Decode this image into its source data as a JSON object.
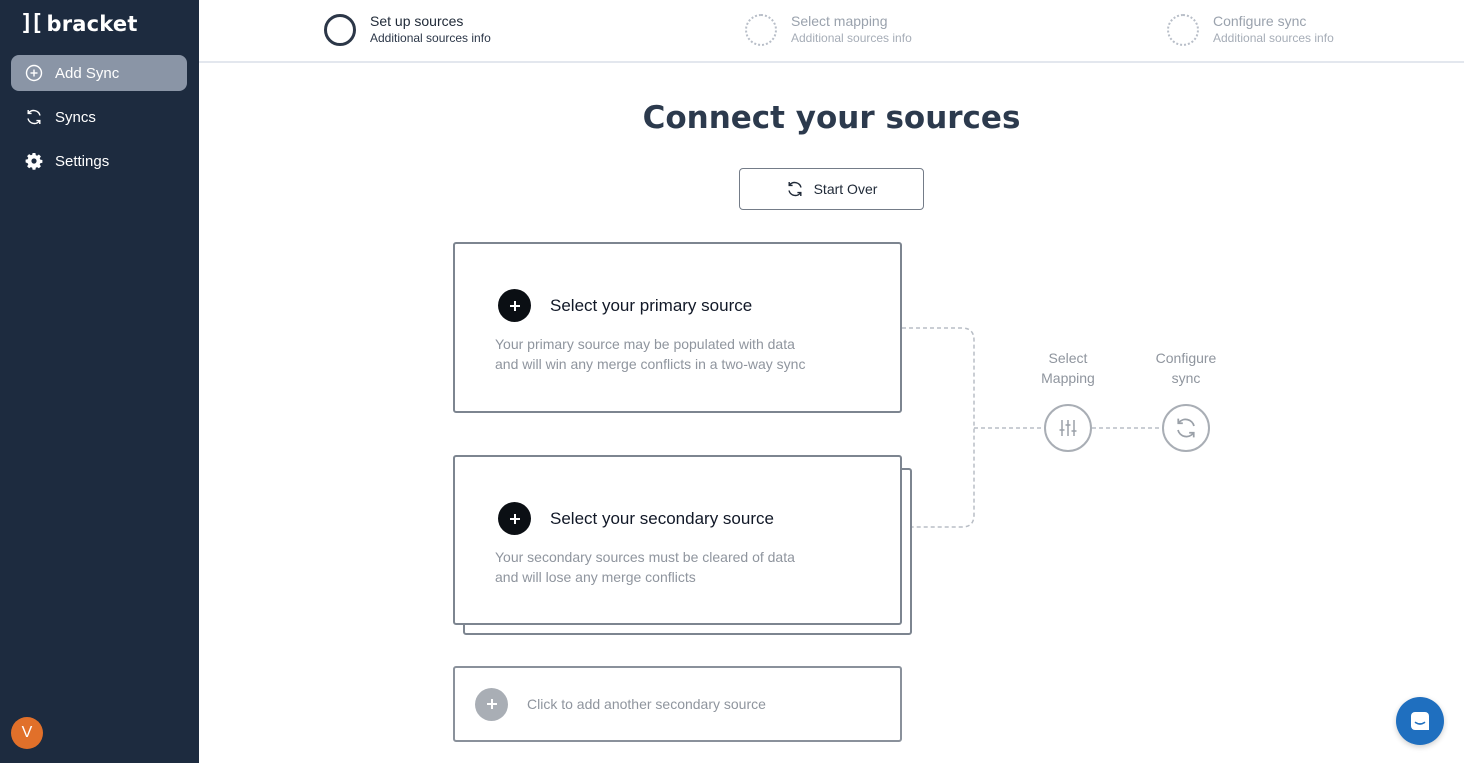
{
  "app": {
    "logo_mark": "][",
    "logo_text": "bracket"
  },
  "sidebar": {
    "items": [
      {
        "label": "Add Sync",
        "icon": "plus-circle-icon",
        "active": true
      },
      {
        "label": "Syncs",
        "icon": "refresh-icon",
        "active": false
      },
      {
        "label": "Settings",
        "icon": "gear-icon",
        "active": false
      }
    ],
    "avatar_initial": "V"
  },
  "stepper": {
    "steps": [
      {
        "title": "Set up sources",
        "subtitle": "Additional sources info",
        "state": "current"
      },
      {
        "title": "Select mapping",
        "subtitle": "Additional sources info",
        "state": "pending"
      },
      {
        "title": "Configure sync",
        "subtitle": "Additional sources info",
        "state": "pending"
      }
    ]
  },
  "main": {
    "title": "Connect your sources",
    "start_over_label": "Start Over",
    "primary": {
      "title": "Select your primary source",
      "desc_line1": "Your primary source may be populated with data",
      "desc_line2": "and will win any merge conflicts in a two-way sync"
    },
    "secondary": {
      "title": "Select your secondary source",
      "desc_line1": "Your secondary sources must be cleared of data",
      "desc_line2": "and will lose any merge conflicts"
    },
    "add_another_label": "Click to add another secondary source",
    "flow": {
      "mapping_line1": "Select",
      "mapping_line2": "Mapping",
      "sync_line1": "Configure",
      "sync_line2": "sync"
    }
  },
  "colors": {
    "sidebar_bg": "#1d2b3f",
    "active_nav_bg": "#8a95a6",
    "avatar_bg": "#e1702a",
    "chat_button_bg": "#1f6fbf"
  },
  "chat": {
    "icon": "chat-icon"
  }
}
